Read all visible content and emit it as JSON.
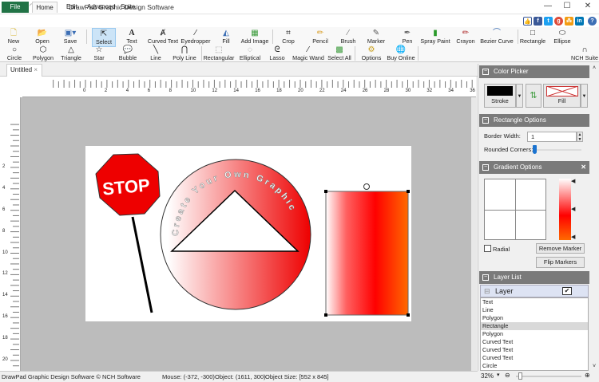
{
  "window": {
    "title": "DrawPad Graphic Design Software"
  },
  "menu_tabs": [
    "File",
    "Home",
    "Edit",
    "Advanced",
    "Suite"
  ],
  "toolbar_row1": [
    "New",
    "Open",
    "Save",
    "Select",
    "Text",
    "Curved Text",
    "Eyedropper",
    "Fill",
    "Add Image",
    "Crop",
    "Pencil",
    "Brush",
    "Marker",
    "Pen",
    "Spray Paint",
    "Crayon",
    "Bezier Curve",
    "Rectangle",
    "Ellipse"
  ],
  "toolbar_row2": [
    "Circle",
    "Polygon",
    "Triangle",
    "Star",
    "Bubble",
    "Line",
    "Poly Line",
    "Rectangular",
    "Elliptical",
    "Lasso",
    "Magic Wand",
    "Select All",
    "Options",
    "Buy Online",
    "NCH Suite"
  ],
  "doc_tab": {
    "label": "Untitled",
    "close": "×"
  },
  "ruler": {
    "h_labels": [
      "0",
      "2",
      "4",
      "6",
      "8",
      "10",
      "12",
      "14",
      "16",
      "18",
      "20",
      "22",
      "24",
      "26",
      "28",
      "30",
      "32",
      "34",
      "36"
    ],
    "v_labels": [
      "2",
      "4",
      "6",
      "8",
      "10",
      "12",
      "14",
      "16",
      "18",
      "20"
    ]
  },
  "canvas": {
    "stop_text": "STOP",
    "curved_text": "Create Your Own Graphic"
  },
  "color_picker": {
    "title": "Color Picker",
    "stroke_label": "Stroke",
    "fill_label": "Fill",
    "stroke_color": "#000000"
  },
  "rectangle_options": {
    "title": "Rectangle Options",
    "border_width_label": "Border Width:",
    "border_width_value": "1",
    "rounded_corners_label": "Rounded Corners:",
    "rounded_corners_value": 0
  },
  "gradient_options": {
    "title": "Gradient Options",
    "radial_label": "Radial",
    "radial_checked": false,
    "remove_marker": "Remove Marker",
    "flip_markers": "Flip Markers",
    "colors": [
      "#ffffff",
      "#ff0000",
      "#ff6600"
    ]
  },
  "layer_list": {
    "title": "Layer List",
    "layer_name": "Layer",
    "layer_visible": true,
    "items": [
      "Text",
      "Line",
      "Polygon",
      "Rectangle",
      "Polygon",
      "Curved Text",
      "Curved Text",
      "Curved Text",
      "Circle"
    ],
    "selected_index": 3
  },
  "status": {
    "app": "DrawPad Graphic Design Software © NCH Software",
    "mouse": "Mouse: (-372, -300)",
    "object": "Object: (1611, 300)",
    "object_size": "Object Size: [552 x 845]"
  },
  "zoom": {
    "value": "32%"
  }
}
